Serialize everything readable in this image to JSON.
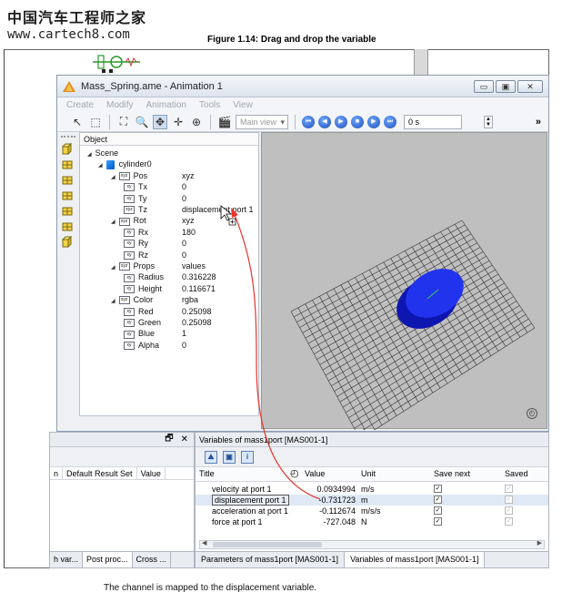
{
  "watermark": {
    "cn": "中国汽车工程师之家",
    "url": "www.cartech8.com"
  },
  "figure_title": "Figure 1.14: Drag and drop the variable",
  "caption": "The channel is mapped to the displacement variable.",
  "window": {
    "title": "Mass_Spring.ame - Animation 1",
    "controls": {
      "minimize": "▭",
      "maximize": "▣",
      "close": "✕"
    },
    "menu": [
      "Create",
      "Modify",
      "Animation",
      "Tools",
      "View"
    ],
    "toolbar": {
      "view_combo": "Main view",
      "time_field": "0 s",
      "more": "»"
    }
  },
  "tree": {
    "header": "Object",
    "rows": [
      {
        "level": 0,
        "arrow": true,
        "icon": "",
        "label": "Scene",
        "value": ""
      },
      {
        "level": 1,
        "arrow": true,
        "icon": "cube",
        "label": "cylinder0",
        "value": ""
      },
      {
        "level": 2,
        "arrow": true,
        "icon": "xyz",
        "label": "Pos",
        "value": "xyz"
      },
      {
        "level": 3,
        "arrow": false,
        "icon": "xy",
        "label": "Tx",
        "value": "0"
      },
      {
        "level": 3,
        "arrow": false,
        "icon": "xy",
        "label": "Ty",
        "value": "0"
      },
      {
        "level": 3,
        "arrow": false,
        "icon": "xyz",
        "label": "Tz",
        "value": "displacement port 1"
      },
      {
        "level": 2,
        "arrow": true,
        "icon": "xyz",
        "label": "Rot",
        "value": "xyz"
      },
      {
        "level": 3,
        "arrow": false,
        "icon": "xy",
        "label": "Rx",
        "value": "180"
      },
      {
        "level": 3,
        "arrow": false,
        "icon": "xy",
        "label": "Ry",
        "value": "0"
      },
      {
        "level": 3,
        "arrow": false,
        "icon": "xy",
        "label": "Rz",
        "value": "0"
      },
      {
        "level": 2,
        "arrow": true,
        "icon": "xyz",
        "label": "Props",
        "value": "values"
      },
      {
        "level": 3,
        "arrow": false,
        "icon": "xy",
        "label": "Radius",
        "value": "0.316228"
      },
      {
        "level": 3,
        "arrow": false,
        "icon": "xy",
        "label": "Height",
        "value": "0.116671"
      },
      {
        "level": 2,
        "arrow": true,
        "icon": "xyz",
        "label": "Color",
        "value": "rgba"
      },
      {
        "level": 3,
        "arrow": false,
        "icon": "xy",
        "label": "Red",
        "value": "0.25098"
      },
      {
        "level": 3,
        "arrow": false,
        "icon": "xy",
        "label": "Green",
        "value": "0.25098"
      },
      {
        "level": 3,
        "arrow": false,
        "icon": "xy",
        "label": "Blue",
        "value": "1"
      },
      {
        "level": 3,
        "arrow": false,
        "icon": "xy",
        "label": "Alpha",
        "value": "0"
      }
    ]
  },
  "lower_left": {
    "pin": "🗗",
    "close": "✕",
    "columns": [
      "n",
      "Default Result Set",
      "Value"
    ],
    "tabs": [
      "h var...",
      "Post proc...",
      "Cross ..."
    ]
  },
  "variables_panel": {
    "title": "Variables of mass1port [MAS001-1]",
    "tool_labels": [
      "⛰",
      "▣",
      "i"
    ],
    "columns": [
      "Title",
      "Value",
      "Unit",
      "Save next",
      "Saved"
    ],
    "rows": [
      {
        "title": "velocity at port 1",
        "value": "0.0934994",
        "unit": "m/s"
      },
      {
        "title": "displacement port 1",
        "value": "-0.731723",
        "unit": "m"
      },
      {
        "title": "acceleration at port 1",
        "value": "-0.112674",
        "unit": "m/s/s"
      },
      {
        "title": "force at port 1",
        "value": "-727.048",
        "unit": "N"
      }
    ],
    "selected_row": 1,
    "tabs": [
      "Parameters of mass1port [MAS001-1]",
      "Variables of mass1port [MAS001-1]"
    ],
    "active_tab": 1
  },
  "icons": {
    "app": "warning-triangle-icon",
    "cylinder": "blue-cylinder",
    "arrow_color": "#e8332b"
  },
  "colors": {
    "cylinder": "#2233ee",
    "grid": "#333333",
    "viewport_bg": "#bfbfbf"
  }
}
